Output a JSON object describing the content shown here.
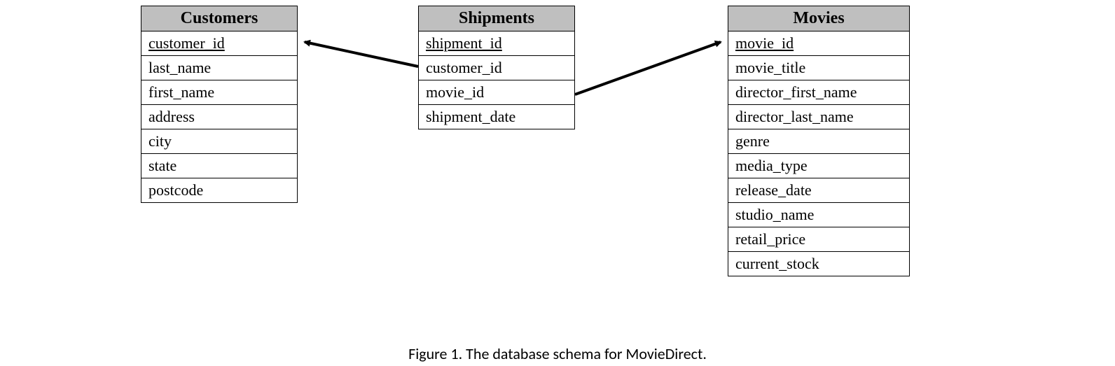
{
  "entities": {
    "customers": {
      "title": "Customers",
      "fields": [
        {
          "name": "customer_id",
          "pk": true
        },
        {
          "name": "last_name",
          "pk": false
        },
        {
          "name": "first_name",
          "pk": false
        },
        {
          "name": "address",
          "pk": false
        },
        {
          "name": "city",
          "pk": false
        },
        {
          "name": "state",
          "pk": false
        },
        {
          "name": "postcode",
          "pk": false
        }
      ]
    },
    "shipments": {
      "title": "Shipments",
      "fields": [
        {
          "name": "shipment_id",
          "pk": true
        },
        {
          "name": "customer_id",
          "pk": false
        },
        {
          "name": "movie_id",
          "pk": false
        },
        {
          "name": "shipment_date",
          "pk": false
        }
      ]
    },
    "movies": {
      "title": "Movies",
      "fields": [
        {
          "name": "movie_id",
          "pk": true
        },
        {
          "name": "movie_title",
          "pk": false
        },
        {
          "name": "director_first_name",
          "pk": false
        },
        {
          "name": "director_last_name",
          "pk": false
        },
        {
          "name": "genre",
          "pk": false
        },
        {
          "name": "media_type",
          "pk": false
        },
        {
          "name": "release_date",
          "pk": false
        },
        {
          "name": "studio_name",
          "pk": false
        },
        {
          "name": "retail_price",
          "pk": false
        },
        {
          "name": "current_stock",
          "pk": false
        }
      ]
    }
  },
  "relationships": [
    {
      "from": "shipments.customer_id",
      "to": "customers.customer_id"
    },
    {
      "from": "shipments.movie_id",
      "to": "movies.movie_id"
    }
  ],
  "caption": "Figure 1. The database schema for MovieDirect."
}
